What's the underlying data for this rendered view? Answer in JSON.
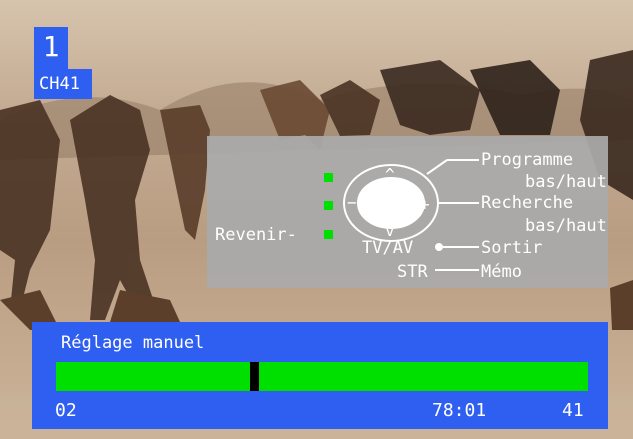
{
  "channel": {
    "number": "1",
    "name": "CH41"
  },
  "help": {
    "programme": "Programme",
    "programme_sub": "bas/haut",
    "recherche": "Recherche",
    "recherche_sub": "bas/haut",
    "revenir": "Revenir-",
    "tvav": "TV/AV",
    "sortir": "Sortir",
    "str": "STR",
    "memo": "Mémo"
  },
  "tuning": {
    "title": "Réglage manuel",
    "progress_fraction": 0.37,
    "left_value": "02",
    "time_value": "78:01",
    "right_value": "41"
  },
  "colors": {
    "blue": "#2f5ff0",
    "green": "#00e000",
    "panel": "#aaaaaa"
  }
}
